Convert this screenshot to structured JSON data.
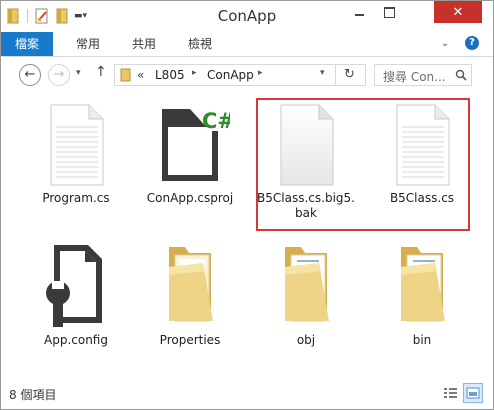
{
  "window": {
    "title": "ConApp"
  },
  "ribbon": {
    "tabs": [
      "檔案",
      "常用",
      "共用",
      "檢視"
    ]
  },
  "address_bar": {
    "prefix": "«",
    "segments": [
      "L805",
      "ConApp"
    ]
  },
  "search": {
    "placeholder": "搜尋 Con..."
  },
  "items": [
    {
      "name": "Program.cs",
      "icon": "text-file-icon"
    },
    {
      "name": "ConApp.csproj",
      "icon": "csharp-project-icon"
    },
    {
      "name": "B5Class.cs.big5.\nbak",
      "icon": "blank-file-icon"
    },
    {
      "name": "B5Class.cs",
      "icon": "text-file-icon"
    },
    {
      "name": "App.config",
      "icon": "config-file-icon"
    },
    {
      "name": "Properties",
      "icon": "folder-icon"
    },
    {
      "name": "obj",
      "icon": "folder-icon"
    },
    {
      "name": "bin",
      "icon": "folder-icon"
    }
  ],
  "status": {
    "item_count": "8 個項目"
  },
  "colors": {
    "accent": "#1979ca",
    "close": "#c7312a",
    "highlight": "#d23a3a",
    "folder": "#e8c867"
  }
}
